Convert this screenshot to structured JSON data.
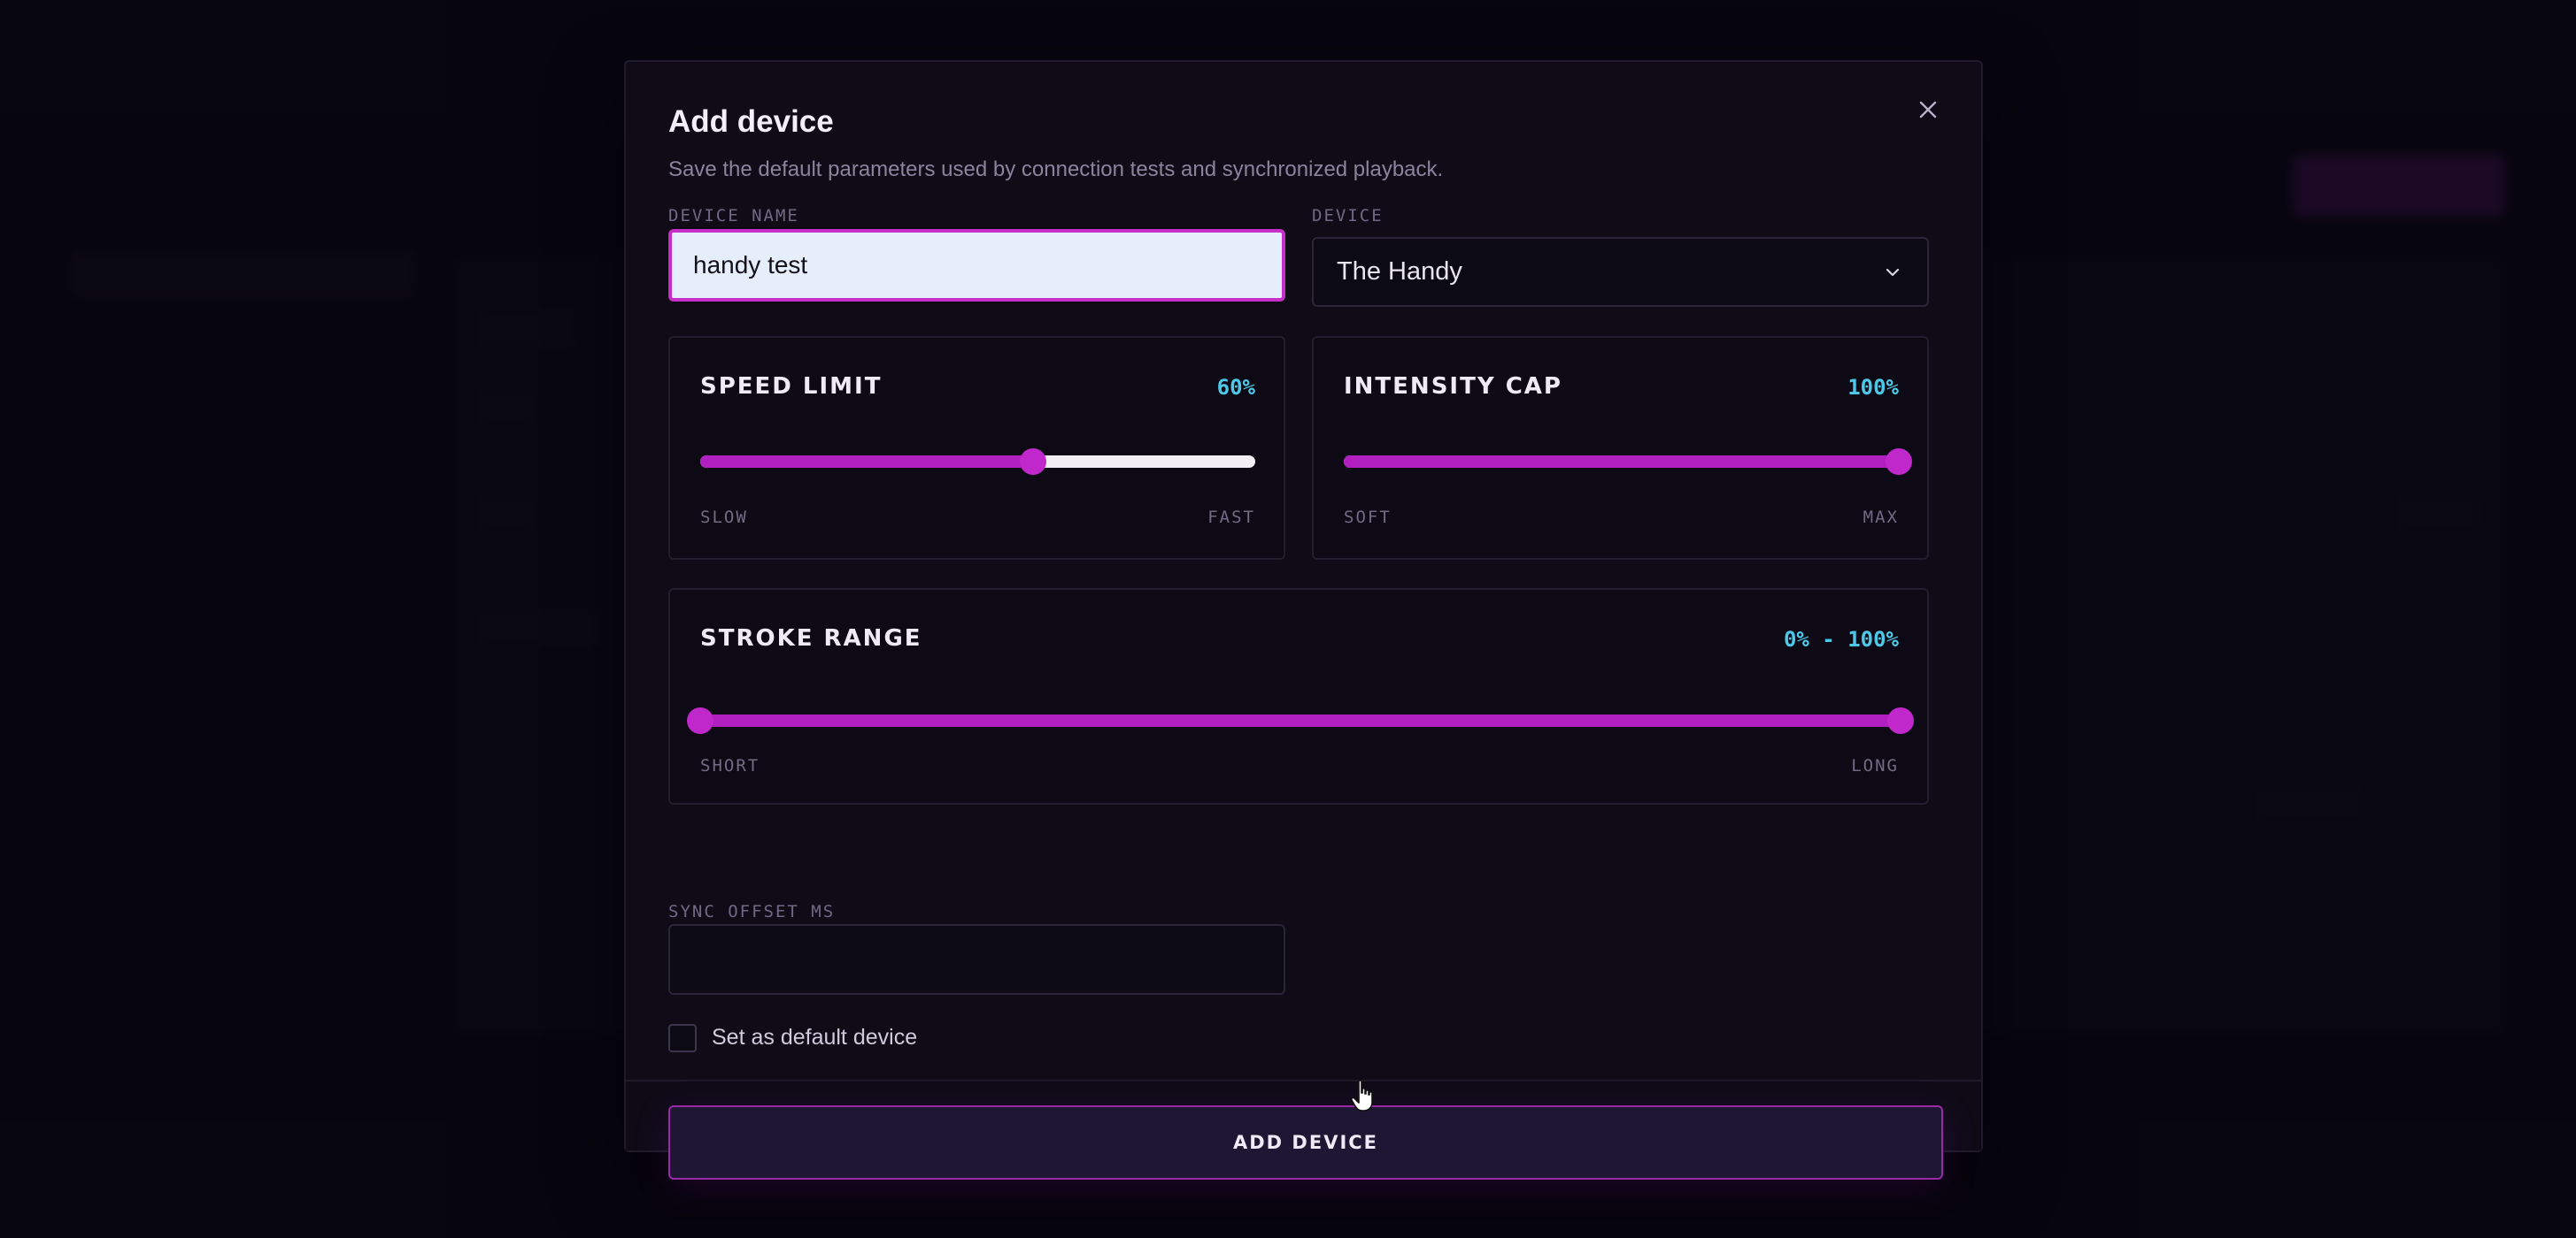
{
  "modal": {
    "title": "Add device",
    "description": "Save the default parameters used by connection tests and synchronized playback.",
    "close_icon": "close-icon"
  },
  "device_name": {
    "label": "DEVICE NAME",
    "value": "handy test"
  },
  "device": {
    "label": "DEVICE",
    "selected": "The Handy",
    "icon": "chevron-down-icon"
  },
  "speed_limit": {
    "title": "SPEED LIMIT",
    "value_text": "60%",
    "value": 0.6,
    "min_label": "SLOW",
    "max_label": "FAST"
  },
  "intensity_cap": {
    "title": "INTENSITY CAP",
    "value_text": "100%",
    "value": 1.0,
    "min_label": "SOFT",
    "max_label": "MAX"
  },
  "stroke_range": {
    "title": "STROKE RANGE",
    "value_text": "0% - 100%",
    "min": 0.0,
    "max": 1.0,
    "min_label": "SHORT",
    "max_label": "LONG"
  },
  "sync_offset": {
    "label": "SYNC OFFSET MS",
    "value": ""
  },
  "default_device": {
    "label": "Set as default device",
    "checked": false
  },
  "submit": {
    "label": "ADD DEVICE"
  },
  "colors": {
    "accent": "#c128cc",
    "value_text": "#4ec8e8",
    "modal_bg": "#0f0c18"
  }
}
